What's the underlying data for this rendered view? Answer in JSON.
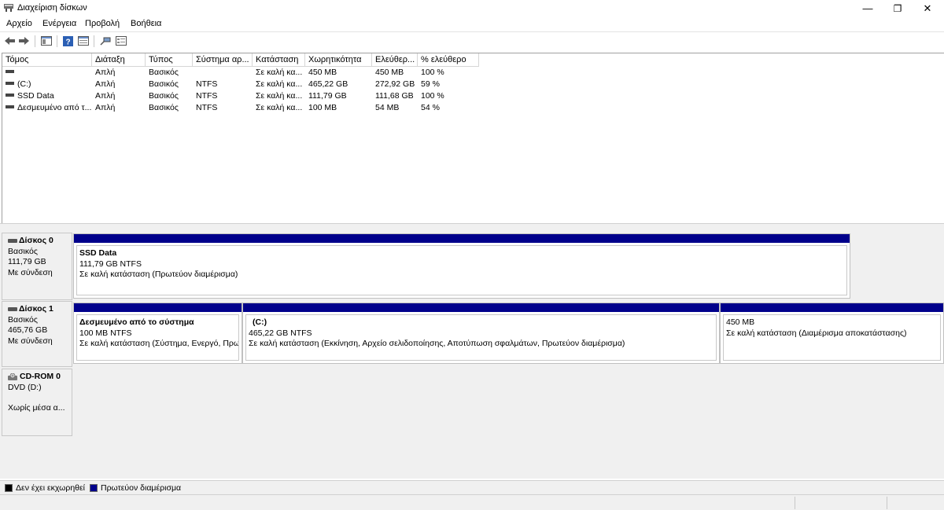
{
  "window": {
    "title": "Διαχείριση δίσκων",
    "minimize_glyph": "—",
    "maximize_glyph": "❐",
    "close_glyph": "✕"
  },
  "menu": {
    "items": [
      {
        "label": "Αρχείο"
      },
      {
        "label": "Ενέργεια"
      },
      {
        "label": "Προβολή"
      },
      {
        "label": "Βοήθεια"
      }
    ]
  },
  "toolbar": {
    "icons": [
      "back-arrow-icon",
      "forward-arrow-icon",
      "show-hide-console-tree-icon",
      "help-icon",
      "properties-icon",
      "connect-icon",
      "view-icon"
    ]
  },
  "volume_list": {
    "columns": [
      "Τόμος",
      "Διάταξη",
      "Τύπος",
      "Σύστημα αρ...",
      "Κατάσταση",
      "Χωρητικότητα",
      "Ελεύθερ...",
      "% ελεύθερο"
    ],
    "rows": [
      {
        "volume": "",
        "layout": "Απλή",
        "type": "Βασικός",
        "fs": "",
        "status": "Σε καλή κα...",
        "capacity": "450 MB",
        "free": "450 MB",
        "pct": "100 %"
      },
      {
        "volume": "(C:)",
        "layout": "Απλή",
        "type": "Βασικός",
        "fs": "NTFS",
        "status": "Σε καλή κα...",
        "capacity": "465,22 GB",
        "free": "272,92 GB",
        "pct": "59 %"
      },
      {
        "volume": "SSD Data",
        "layout": "Απλή",
        "type": "Βασικός",
        "fs": "NTFS",
        "status": "Σε καλή κα...",
        "capacity": "111,79 GB",
        "free": "111,68 GB",
        "pct": "100 %"
      },
      {
        "volume": "Δεσμευμένο από τ...",
        "layout": "Απλή",
        "type": "Βασικός",
        "fs": "NTFS",
        "status": "Σε καλή κα...",
        "capacity": "100 MB",
        "free": "54 MB",
        "pct": "54 %"
      }
    ]
  },
  "disks": {
    "disk0": {
      "name": "Δίσκος 0",
      "type": "Βασικός",
      "size": "111,79 GB",
      "state": "Με σύνδεση",
      "partitions": [
        {
          "name": "SSD Data",
          "size": "111,79 GB NTFS",
          "status": "Σε καλή κατάσταση (Πρωτεύον διαμέρισμα)"
        }
      ]
    },
    "disk1": {
      "name": "Δίσκος 1",
      "type": "Βασικός",
      "size": "465,76 GB",
      "state": "Με σύνδεση",
      "partitions": [
        {
          "name": "Δεσμευμένο από το σύστημα",
          "size": "100 MB NTFS",
          "status": "Σε καλή κατάσταση (Σύστημα, Ενεργό, Πρω"
        },
        {
          "name": "(C:)",
          "size": "465,22 GB NTFS",
          "status": "Σε καλή κατάσταση (Εκκίνηση, Αρχείο σελιδοποίησης, Αποτύπωση σφαλμάτων, Πρωτεύον διαμέρισμα)"
        },
        {
          "name": "",
          "size": "450 MB",
          "status": "Σε καλή κατάσταση (Διαμέρισμα αποκατάστασης)"
        }
      ]
    },
    "cdrom0": {
      "name": "CD-ROM 0",
      "drive": "DVD (D:)",
      "state": "Χωρίς μέσα α..."
    }
  },
  "legend": {
    "items": [
      {
        "label": "Δεν έχει εκχωρηθεί",
        "color": "#000000"
      },
      {
        "label": "Πρωτεύον διαμέρισμα",
        "color": "#00008b"
      }
    ]
  }
}
